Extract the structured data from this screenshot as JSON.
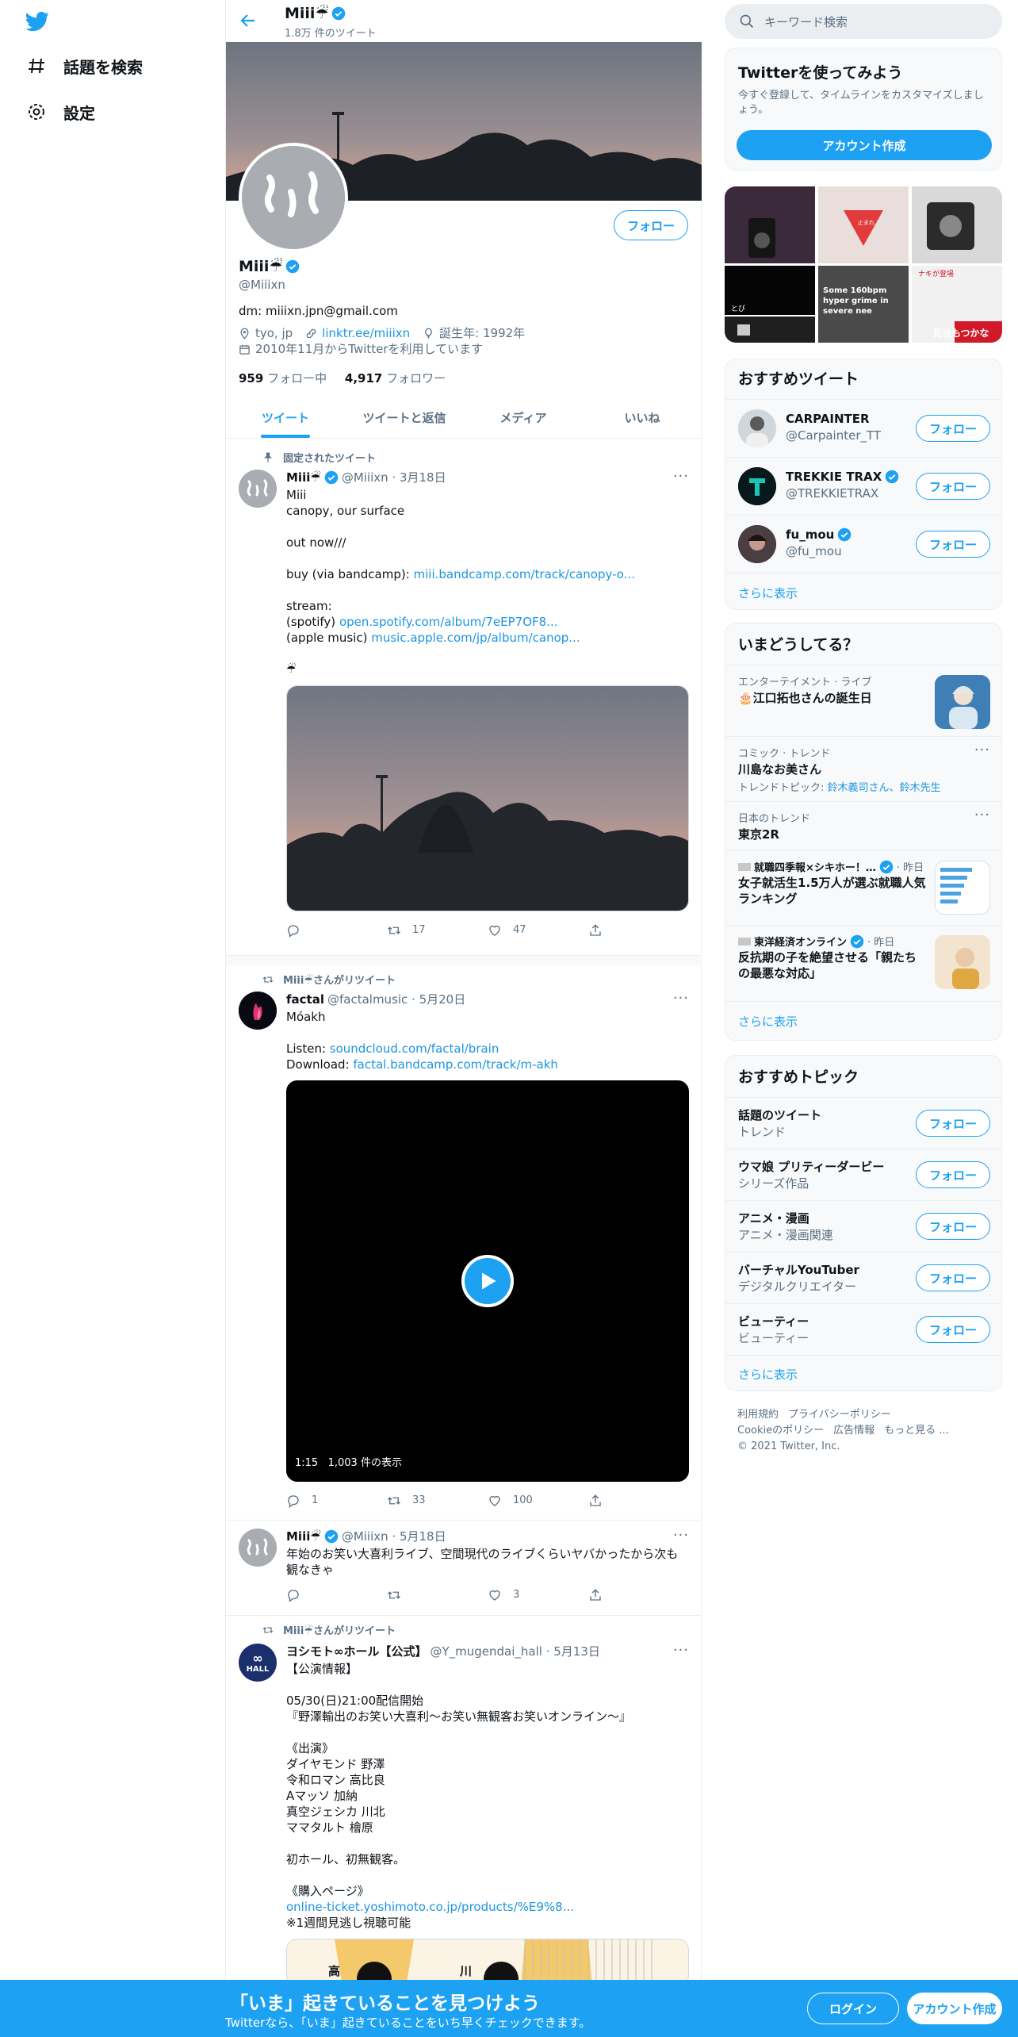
{
  "nav": {
    "explore": "話題を検索",
    "settings": "設定"
  },
  "header": {
    "name": "Miii☔",
    "tweet_count": "1.8万 件のツイート"
  },
  "profile": {
    "follow": "フォロー",
    "name": "Miii☔",
    "handle": "@Miiixn",
    "bio": "dm: miiixn.jpn@gmail.com",
    "location": "tyo, jp",
    "link": "linktr.ee/miiixn",
    "birthday": "誕生年: 1992年",
    "joined": "2010年11月からTwitterを利用しています",
    "following_count": "959",
    "following_label": "フォロー中",
    "followers_count": "4,917",
    "followers_label": "フォロワー"
  },
  "tabs": [
    "ツイート",
    "ツイートと返信",
    "メディア",
    "いいね"
  ],
  "tweets": [
    {
      "context": "固定されたツイート",
      "name": "Miii☔",
      "handle": "@Miiixn · 3月18日",
      "lines": [
        "Miii",
        "canopy, our surface",
        "",
        "out now///",
        ""
      ],
      "buy_prefix": "buy (via bandcamp): ",
      "buy_link": "miii.bandcamp.com/track/canopy-o...",
      "stream": "stream:",
      "spotify_prefix": "(spotify) ",
      "spotify_link": "open.spotify.com/album/7eEP7OF8...",
      "apple_prefix": "(apple music) ",
      "apple_link": "music.apple.com/jp/album/canop...",
      "emoji": "☔",
      "reply": "",
      "retweets": "17",
      "likes": "47"
    },
    {
      "context": "Miii☔さんがリツイート",
      "name": "factal",
      "handle": "@factalmusic · 5月20日",
      "title": "Mόakh",
      "listen_prefix": "Listen: ",
      "listen_link": "soundcloud.com/factal/brain",
      "download_prefix": "Download: ",
      "download_link": "factal.bandcamp.com/track/m-akh",
      "video_time": "1:15",
      "video_views": "1,003 件の表示",
      "reply": "1",
      "retweets": "33",
      "likes": "100"
    },
    {
      "name": "Miii☔",
      "handle": "@Miiixn · 5月18日",
      "text": "年始のお笑い大喜利ライブ、空間現代のライブくらいヤバかったから次も観なきゃ",
      "reply": "",
      "retweets": "",
      "likes": "3"
    },
    {
      "context": "Miii☔さんがリツイート",
      "name": "ヨシモト∞ホール【公式】",
      "handle": "@Y_mugendai_hall · 5月13日",
      "avatar_text": "HALL",
      "text": "【公演情報】\n\n05/30(日)21:00配信開始\n『野澤輸出のお笑い大喜利〜お笑い無観客お笑いオンライン〜』\n\n《出演》\nダイヤモンド 野澤\n令和ロマン 高比良\nAマッソ 加納\n真空ジェシカ 川北\nママタルト 檜原\n\n初ホール、初無観客。\n\n《購入ページ》",
      "link": "online-ticket.yoshimoto.co.jp/products/%E9%8...",
      "note": "※1週間見逃し視聴可能",
      "media_chars": [
        "高",
        "川"
      ]
    }
  ],
  "right": {
    "search_placeholder": "キーワード検索",
    "signup_box": {
      "title": "Twitterを使ってみよう",
      "subtitle": "今すぐ登録して、タイムラインをカスタマイズしましょう。",
      "button": "アカウント作成"
    },
    "media_grid": {
      "caption1": "とび",
      "caption2": "Some 160bpm hyper grime in severe nee",
      "caption3": "見当もつかな",
      "sign": "止まれ",
      "tag": "ナキが登場"
    },
    "who_to_follow": {
      "title": "おすすめツイート",
      "users": [
        {
          "name": "CARPAINTER",
          "handle": "@Carpainter_TT",
          "button": "フォロー"
        },
        {
          "name": "TREKKIE TRAX",
          "handle": "@TREKKIETRAX",
          "button": "フォロー"
        },
        {
          "name": "fu_mou",
          "handle": "@fu_mou",
          "button": "フォロー"
        }
      ],
      "show_more": "さらに表示"
    },
    "trends": {
      "title": "いまどうしてる？",
      "items": [
        {
          "context": "エンターテイメント · ライブ",
          "title": "🎂江口拓也さんの誕生日"
        },
        {
          "context": "コミック · トレンド",
          "title": "川島なお美さん",
          "sub_prefix": "トレンドトピック: ",
          "sub_links": "鈴木義司さん、鈴木先生"
        },
        {
          "context": "日本のトレンド",
          "title": "東京2R"
        },
        {
          "context": "就職四季報×シキホー！…",
          "time": "· 昨日",
          "title": "女子就活生1.5万人が選ぶ就職人気ランキング"
        },
        {
          "context": "東洋経済オンライン",
          "time": "· 昨日",
          "title": "反抗期の子を絶望させる「親たちの最悪な対応」"
        }
      ],
      "show_more": "さらに表示"
    },
    "topics": {
      "title": "おすすめトピック",
      "items": [
        {
          "name": "話題のツイート",
          "sub": "トレンド",
          "button": "フォロー"
        },
        {
          "name": "ウマ娘 プリティーダービー",
          "sub": "シリーズ作品",
          "button": "フォロー"
        },
        {
          "name": "アニメ・漫画",
          "sub": "アニメ・漫画関連",
          "button": "フォロー"
        },
        {
          "name": "バーチャルYouTuber",
          "sub": "デジタルクリエイター",
          "button": "フォロー"
        },
        {
          "name": "ビューティー",
          "sub": "ビューティー",
          "button": "フォロー"
        }
      ],
      "show_more": "さらに表示"
    },
    "footer": {
      "terms": "利用規約",
      "privacy": "プライバシーポリシー",
      "cookie": "Cookieのポリシー",
      "ads": "広告情報",
      "more": "もっと見る ...",
      "copyright": "© 2021 Twitter, Inc."
    }
  },
  "bottom_bar": {
    "title": "「いま」起きていることを見つけよう",
    "subtitle": "Twitterなら、「いま」起きていることをいち早くチェックできます。",
    "login": "ログイン",
    "signup": "アカウント作成"
  },
  "colors": {
    "brand": "#1da1f2",
    "link": "#1b95e0",
    "muted": "#5b7083"
  }
}
